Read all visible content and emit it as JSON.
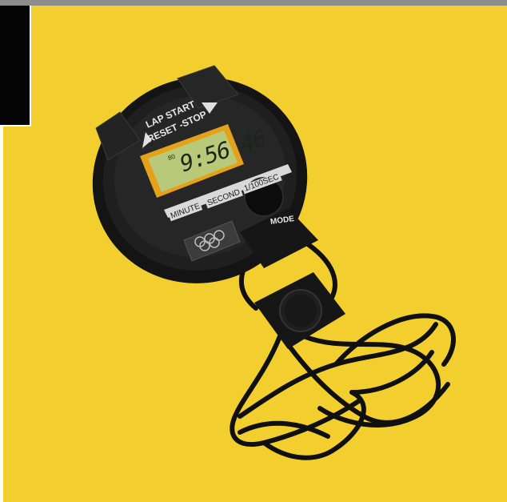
{
  "display": {
    "time": "9:56 46",
    "indicator": "80"
  },
  "buttons": {
    "lap_start": "LAP START",
    "reset_stop": "RESET -STOP"
  },
  "units": {
    "minute": "MINUTE",
    "second": "SECOND",
    "sub_second": "1/100SEC"
  },
  "mode_label": "MODE",
  "colors": {
    "background": "#f2cf2e",
    "body": "#1c1c1c",
    "lcd": "#b9c97a",
    "lcd_frame": "#e6a11a"
  }
}
